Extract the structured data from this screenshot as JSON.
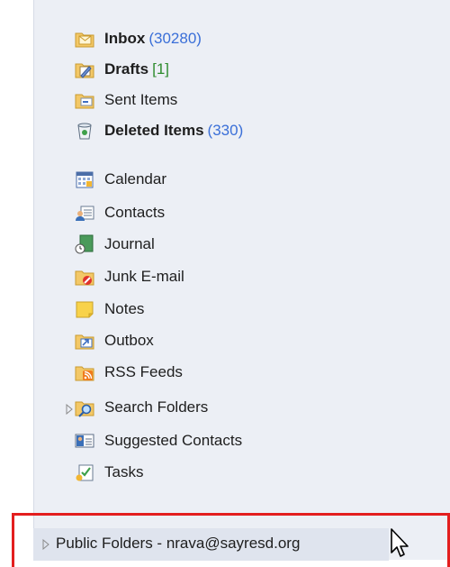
{
  "folders": [
    {
      "label": "Inbox",
      "count": "(30280)",
      "count_color": "blue",
      "bold": true,
      "icon": "inbox-icon"
    },
    {
      "label": "Drafts",
      "count": "[1]",
      "count_color": "green",
      "bold": true,
      "icon": "drafts-icon"
    },
    {
      "label": "Sent Items",
      "count": "",
      "bold": false,
      "icon": "sent-items-icon"
    },
    {
      "label": "Deleted Items",
      "count": "(330)",
      "count_color": "blue",
      "bold": true,
      "icon": "deleted-items-icon"
    },
    {
      "label": "Calendar",
      "count": "",
      "bold": false,
      "icon": "calendar-icon"
    },
    {
      "label": "Contacts",
      "count": "",
      "bold": false,
      "icon": "contacts-icon"
    },
    {
      "label": "Journal",
      "count": "",
      "bold": false,
      "icon": "journal-icon"
    },
    {
      "label": "Junk E-mail",
      "count": "",
      "bold": false,
      "icon": "junk-email-icon"
    },
    {
      "label": "Notes",
      "count": "",
      "bold": false,
      "icon": "notes-icon"
    },
    {
      "label": "Outbox",
      "count": "",
      "bold": false,
      "icon": "outbox-icon"
    },
    {
      "label": "RSS Feeds",
      "count": "",
      "bold": false,
      "icon": "rss-feeds-icon"
    },
    {
      "label": "Search Folders",
      "count": "",
      "bold": false,
      "icon": "search-folders-icon",
      "expandable": true
    },
    {
      "label": "Suggested Contacts",
      "count": "",
      "bold": false,
      "icon": "suggested-contacts-icon"
    },
    {
      "label": "Tasks",
      "count": "",
      "bold": false,
      "icon": "tasks-icon"
    }
  ],
  "public_folders": {
    "label": "Public Folders - nrava@sayresd.org",
    "expandable": true
  },
  "colors": {
    "highlight_border": "#e31e1e",
    "count_blue": "#3a6fd8",
    "count_green": "#2e8b2e",
    "pane_bg": "#eceff5"
  }
}
